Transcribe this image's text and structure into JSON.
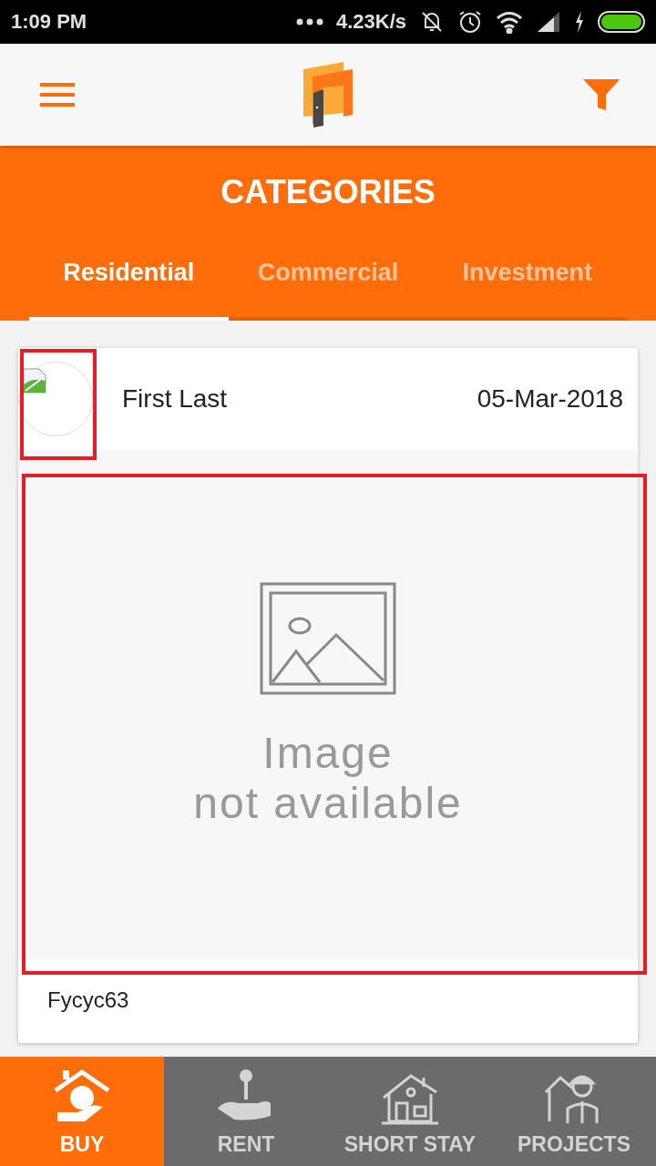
{
  "status_bar": {
    "time": "1:09 PM",
    "speed": "4.23K/s"
  },
  "header": {
    "title": "CATEGORIES"
  },
  "tabs": [
    {
      "label": "Residential",
      "selected": true
    },
    {
      "label": "Commercial",
      "selected": false
    },
    {
      "label": "Investment",
      "selected": false
    }
  ],
  "post": {
    "author": "First Last",
    "date": "05-Mar-2018",
    "image_text": [
      "Image",
      "not available"
    ],
    "caption": "Fycyc63"
  },
  "bottom_nav": [
    {
      "label": "BUY",
      "kind": "buy",
      "selected": true
    },
    {
      "label": "RENT",
      "kind": "rent",
      "selected": false
    },
    {
      "label": "SHORT STAY",
      "kind": "stay",
      "selected": false
    },
    {
      "label": "PROJECTS",
      "kind": "projects",
      "selected": false
    }
  ]
}
